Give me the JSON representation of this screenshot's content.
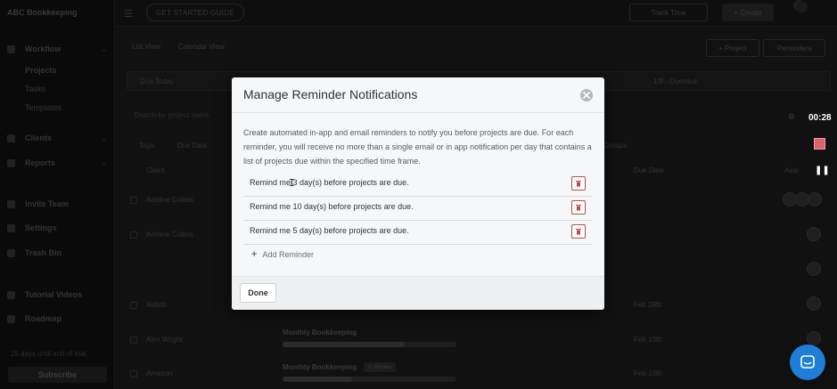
{
  "sidebar": {
    "brand": "ABC Bookkeeping",
    "items": [
      {
        "label": "Workflow"
      },
      {
        "label": "Projects"
      },
      {
        "label": "Tasks"
      },
      {
        "label": "Templates"
      },
      {
        "label": "Clients"
      },
      {
        "label": "Reports"
      },
      {
        "label": "Invite Team"
      },
      {
        "label": "Settings"
      },
      {
        "label": "Trash Bin"
      },
      {
        "label": "Tutorial Videos"
      },
      {
        "label": "Roadmap"
      }
    ],
    "trial_text": "15 days until end of trial",
    "subscribe_label": "Subscribe"
  },
  "topbar": {
    "guide_label": "GET STARTED GUIDE",
    "track_time_label": "Track Time",
    "create_label": "+ Create"
  },
  "toolbar": {
    "list_view": "List View",
    "calendar_view": "Calendar View",
    "project_label": "+ Project",
    "reminders_label": "Reminders"
  },
  "duebar": {
    "due_today": "Due Today",
    "overdue": "1/8 - Overdue"
  },
  "filters": {
    "search_placeholder": "Search by project name",
    "tags": "Tags",
    "due_date": "Due Date",
    "groups": "Groups"
  },
  "table": {
    "col_client": "Client",
    "col_due": "Due Date",
    "col_assignee": "Assi",
    "rows": [
      {
        "client": "Adeline Collins",
        "project": "",
        "date": ""
      },
      {
        "client": "Adeline Collins",
        "project": "",
        "date": ""
      },
      {
        "client": "Airbnb",
        "project": "",
        "date": "Feb 28th"
      },
      {
        "client": "Alex Wright",
        "project": "Monthly Bookkeeping",
        "date": "Feb 10th"
      },
      {
        "client": "Amazon",
        "project": "Monthly Bookkeeping",
        "date": "Feb 10th",
        "badge": "In Review"
      }
    ]
  },
  "recorder": {
    "time": "00:28"
  },
  "modal": {
    "title": "Manage Reminder Notifications",
    "description": "Create automated in-app and email reminders to notify you before projects are due. For each reminder, you will receive no more than a single email or in app notification per day that contains a list of projects due within the specified time frame.",
    "reminders": [
      {
        "text": "Remind me 3 day(s) before projects are due."
      },
      {
        "text": "Remind me 10 day(s) before projects are due."
      },
      {
        "text": "Remind me 5 day(s) before projects are due."
      }
    ],
    "add_label": "Add Reminder",
    "done_label": "Done"
  },
  "colors": {
    "accent": "#1f7fd6",
    "delete": "#b84a4a",
    "record_stop": "#d9646d"
  }
}
